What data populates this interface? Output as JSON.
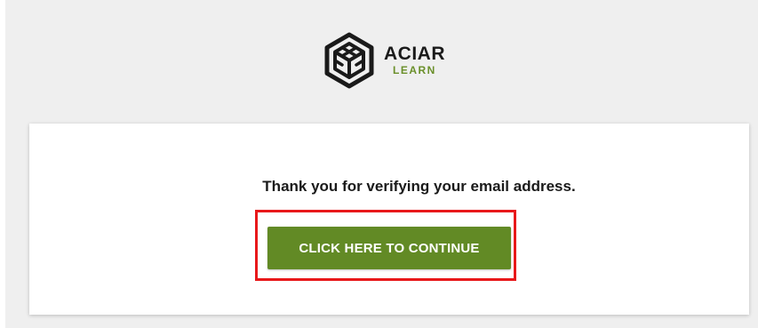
{
  "brand": {
    "name": "ACIAR",
    "subtitle": "LEARN",
    "logo_icon": "hexagon-knot-icon",
    "name_color": "#1a1a1a",
    "subtitle_color": "#6a8f2a"
  },
  "card": {
    "message": "Thank you for verifying your email address.",
    "continue_label": "CLICK HERE TO CONTINUE",
    "button_color": "#628a25",
    "highlight_color": "#e8181a"
  }
}
